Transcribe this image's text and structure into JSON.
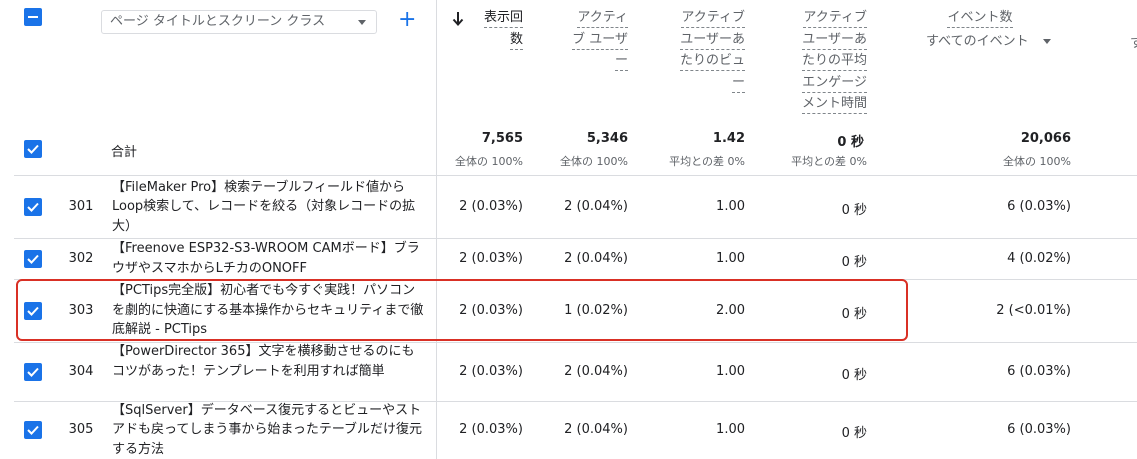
{
  "header": {
    "dimension_dropdown": "ページ タイトルとスクリーン クラス",
    "columns": [
      {
        "lines": [
          "表示回",
          "数"
        ],
        "sorted": true
      },
      {
        "lines": [
          "アクティ",
          "ブ ユーザ",
          "ー"
        ]
      },
      {
        "lines": [
          "アクティブ",
          "ユーザーあ",
          "たりのビュ",
          "ー"
        ]
      },
      {
        "lines": [
          "アクティブ",
          "ユーザーあ",
          "たりの平均",
          "エンゲージ",
          "メント時間"
        ]
      }
    ],
    "event_column": {
      "label": "イベント数",
      "filter": "すべてのイベント",
      "next_fragment": "す"
    }
  },
  "totals": {
    "label": "合計",
    "values": [
      "7,565",
      "5,346",
      "1.42",
      "0 秒",
      "20,066"
    ],
    "subs": [
      "全体の 100%",
      "全体の 100%",
      "平均との差 0%",
      "平均との差 0%",
      "全体の 100%"
    ]
  },
  "rows": [
    {
      "num": "301",
      "title": "【FileMaker Pro】検索テーブルフィールド値からLoop検索して、レコードを絞る（対象レコードの拡大）",
      "values": [
        "2 (0.03%)",
        "2 (0.04%)",
        "1.00",
        "0 秒",
        "6 (0.03%)"
      ]
    },
    {
      "num": "302",
      "title": "【Freenove ESP32-S3-WROOM CAMボード】ブラウザやスマホからLチカのONOFF",
      "values": [
        "2 (0.03%)",
        "2 (0.04%)",
        "1.00",
        "0 秒",
        "4 (0.02%)"
      ]
    },
    {
      "num": "303",
      "title": "【PCTips完全版】初心者でも今すぐ実践！パソコンを劇的に快適にする基本操作からセキュリティまで徹底解説 - PCTips",
      "values": [
        "2 (0.03%)",
        "1 (0.02%)",
        "2.00",
        "0 秒",
        "2 (<0.01%)"
      ],
      "highlighted": true
    },
    {
      "num": "304",
      "title": "【PowerDirector 365】文字を横移動させるのにもコツがあった！テンプレートを利用すれば簡単",
      "values": [
        "2 (0.03%)",
        "2 (0.04%)",
        "1.00",
        "0 秒",
        "6 (0.03%)"
      ]
    },
    {
      "num": "305",
      "title": "【SqlServer】データベース復元するとビューやストアドも戻ってしまう事から始まったテーブルだけ復元する方法",
      "values": [
        "2 (0.03%)",
        "2 (0.04%)",
        "1.00",
        "0 秒",
        "6 (0.03%)"
      ]
    }
  ]
}
